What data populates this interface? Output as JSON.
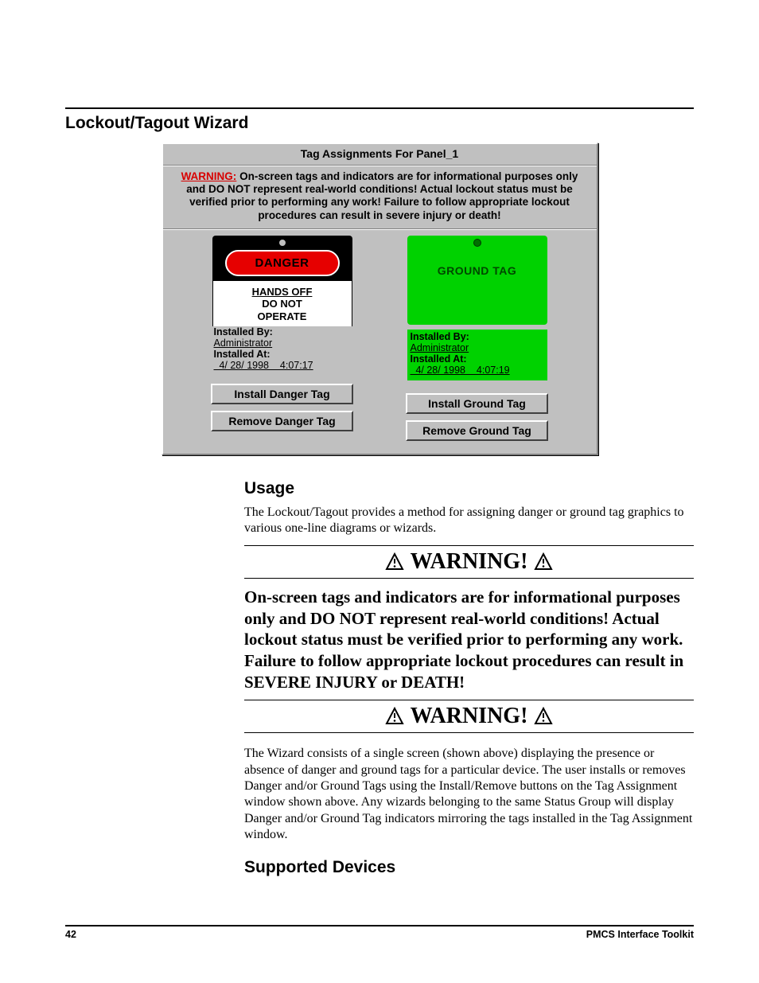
{
  "page": {
    "number": "42",
    "doc_title": "PMCS Interface Toolkit"
  },
  "section_title": "Lockout/Tagout Wizard",
  "dialog": {
    "title": "Tag Assignments For Panel_1",
    "warning_prefix": "WARNING:",
    "warning_text": "On-screen tags and indicators are for informational purposes only and DO NOT represent real-world conditions!  Actual lockout status must be verified prior to performing any work!  Failure to follow appropriate lockout procedures can result in severe injury or death!",
    "danger": {
      "pill": "DANGER",
      "line1": "HANDS OFF",
      "line2": "DO NOT",
      "line3": "OPERATE",
      "installed_by_label": "Installed By:",
      "installed_by_value": "Administrator",
      "installed_at_label": "Installed At:",
      "installed_at_value": "  4/ 28/ 1998    4:07:17",
      "install_btn": "Install Danger Tag",
      "remove_btn": "Remove Danger Tag"
    },
    "ground": {
      "label": "GROUND TAG",
      "installed_by_label": "Installed By:",
      "installed_by_value": "Administrator",
      "installed_at_label": "Installed At:",
      "installed_at_value": "  4/ 28/ 1998    4:07:19",
      "install_btn": "Install Ground Tag",
      "remove_btn": "Remove Ground Tag"
    }
  },
  "usage": {
    "heading": "Usage",
    "text": "The Lockout/Tagout provides a method for assigning danger or ground tag graphics to various one-line diagrams or wizards."
  },
  "warning_header": "WARNING!",
  "warning_body": "On-screen tags and indicators are for informational purposes only and DO NOT represent real-world conditions! Actual lockout status must be verified prior to performing any work. Failure to follow appropriate lockout procedures can result in SEVERE INJURY or DEATH!",
  "wizard_desc": "The Wizard consists of a single screen (shown above) displaying the presence or absence of danger and ground tags for a particular device. The user installs or removes Danger and/or Ground Tags using the Install/Remove buttons on the Tag Assignment window shown above. Any wizards belonging to the same Status Group will display Danger and/or Ground Tag indicators mirroring the tags installed in the Tag Assignment window.",
  "devices": {
    "heading": "Supported Devices"
  }
}
